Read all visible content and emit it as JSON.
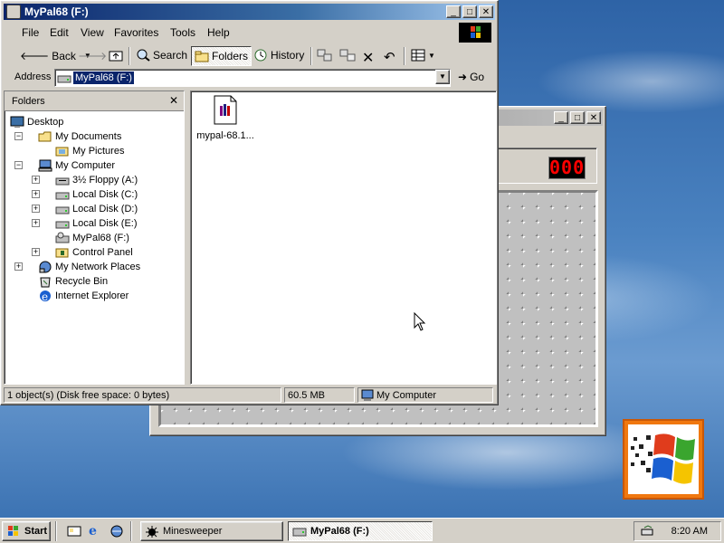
{
  "colors": {
    "desktop": "#3a6ea5",
    "title_active": "#0a246a",
    "selection": "#0a246a",
    "window_face": "#d4d0c8",
    "logo_orange": "#f07810"
  },
  "minesweeper": {
    "counter": "000",
    "controls": {
      "minimize": "_",
      "maximize": "□",
      "close": "✕"
    }
  },
  "explorer": {
    "title": "MyPal68 (F:)",
    "controls": {
      "minimize": "_",
      "maximize": "□",
      "close": "✕"
    },
    "menu": [
      "File",
      "Edit",
      "View",
      "Favorites",
      "Tools",
      "Help"
    ],
    "toolbar": {
      "back": "Back",
      "search": "Search",
      "folders": "Folders",
      "history": "History"
    },
    "address": {
      "label": "Address",
      "value": "MyPal68 (F:)",
      "go": "Go"
    },
    "folders_pane": {
      "title": "Folders",
      "close": "✕",
      "tree": [
        {
          "label": "Desktop",
          "icon": "desktop-icon"
        },
        {
          "label": "My Documents",
          "icon": "folder-open-icon",
          "expander": "−"
        },
        {
          "label": "My Pictures",
          "icon": "pictures-folder-icon"
        },
        {
          "label": "My Computer",
          "icon": "computer-icon",
          "expander": "−"
        },
        {
          "label": "3½ Floppy (A:)",
          "icon": "floppy-drive-icon",
          "expander": "+"
        },
        {
          "label": "Local Disk (C:)",
          "icon": "hard-disk-icon",
          "expander": "+"
        },
        {
          "label": "Local Disk (D:)",
          "icon": "hard-disk-icon",
          "expander": "+"
        },
        {
          "label": "Local Disk (E:)",
          "icon": "hard-disk-icon",
          "expander": "+"
        },
        {
          "label": "MyPal68 (F:)",
          "icon": "removable-drive-icon"
        },
        {
          "label": "Control Panel",
          "icon": "control-panel-icon",
          "expander": "+"
        },
        {
          "label": "My Network Places",
          "icon": "network-icon",
          "expander": "+"
        },
        {
          "label": "Recycle Bin",
          "icon": "recycle-bin-icon"
        },
        {
          "label": "Internet Explorer",
          "icon": "ie-icon"
        }
      ]
    },
    "files": [
      {
        "name": "mypal-68.1...",
        "icon": "installer-file-icon"
      }
    ],
    "status": {
      "objects": "1 object(s) (Disk free space: 0 bytes)",
      "size": "60.5 MB",
      "zone": "My Computer"
    }
  },
  "taskbar": {
    "start": "Start",
    "tasks": [
      {
        "label": "Minesweeper",
        "icon": "minesweeper-icon",
        "active": false
      },
      {
        "label": "MyPal68 (F:)",
        "icon": "drive-icon",
        "active": true
      }
    ],
    "clock": "8:20 AM"
  }
}
